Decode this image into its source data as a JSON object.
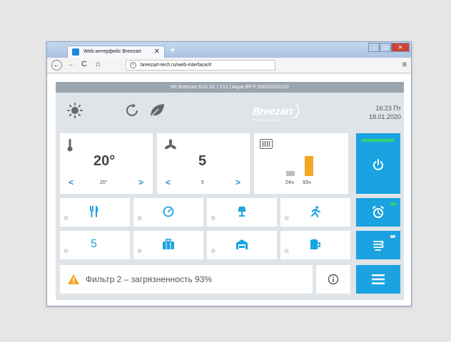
{
  "browser": {
    "tab_title": "Web-интерфейс Breezart",
    "tab_close": "✕",
    "new_tab": "+",
    "url": "breezart-tech.ru/web-interface/#",
    "back": "←",
    "forward": "→",
    "reload": "C",
    "home": "⌂",
    "menu": "≡",
    "url_info": "i",
    "win_min": "‒",
    "win_max": "▭",
    "win_close": "✕"
  },
  "app": {
    "info_bar": "WI Breezart 6.01.02 | V12 | Aqua RP F 0002X010120",
    "brand": "Breezart",
    "brand_tagline": "The art of the ventilation",
    "time": "16:23 Пт",
    "date": "18.01.2020",
    "temperature": {
      "value": "20°",
      "setpoint": "20°",
      "prev": "<",
      "next": ">"
    },
    "fan": {
      "value": "5",
      "setpoint": "5",
      "prev": "<",
      "next": ">"
    },
    "filter": {
      "levels": [
        0.24,
        0.93
      ],
      "label_1_value": "24",
      "label_1_unit": "%",
      "label_2_value": "93",
      "label_2_unit": "%"
    },
    "scenes_row1": [
      "restaurant-icon",
      "gauge-icon",
      "lamp-icon",
      "runner-icon"
    ],
    "scenes_row2": {
      "number": "5",
      "icons": [
        "briefcase-icon",
        "garage-icon",
        "beer-icon"
      ]
    },
    "gear_glyph": "⚙",
    "alert_text": "Фильтр 2 – загрязненность 93%",
    "colors": {
      "accent": "#1aa3e0",
      "power_indicator": "#2ed573",
      "filter_bar_high": "#f5a623",
      "filter_bar_low": "#bdbdbd",
      "alert_icon": "#f5a623",
      "info_bar": "#9aa5ae",
      "panel_bg": "#dfe4e8"
    }
  }
}
